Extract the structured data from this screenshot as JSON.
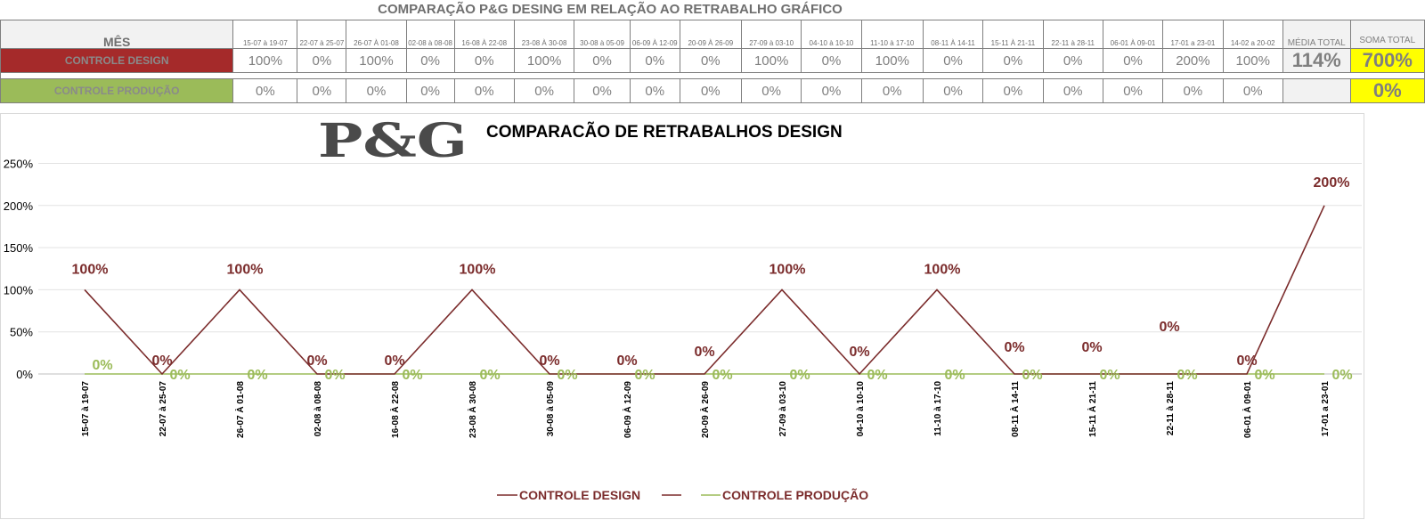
{
  "page_title": "COMPARAÇÃO P&G DESING EM RELAÇÃO AO RETRABALHO GRÁFICO",
  "table": {
    "month_header": "MÊS",
    "periods": [
      "15-07 à 19-07",
      "22-07 à 25-07",
      "26-07 À 01-08",
      "02-08 à 08-08",
      "16-08 À 22-08",
      "23-08 À 30-08",
      "30-08 à 05-09",
      "06-09 À 12-09",
      "20-09 À 26-09",
      "27-09 à 03-10",
      "04-10 à 10-10",
      "11-10 à 17-10",
      "08-11 À 14-11",
      "15-11 À 21-11",
      "22-11 à 28-11",
      "06-01 À 09-01",
      "17-01 a 23-01",
      "14-02 a 20-02"
    ],
    "media_total_header": "MÉDIA TOTAL",
    "soma_total_header": "SOMA TOTAL",
    "rows": [
      {
        "label": "CONTROLE DESIGN",
        "color": "#a52a2a",
        "values": [
          "100%",
          "0%",
          "100%",
          "0%",
          "0%",
          "100%",
          "0%",
          "0%",
          "0%",
          "100%",
          "0%",
          "100%",
          "0%",
          "0%",
          "0%",
          "0%",
          "200%",
          "100%"
        ],
        "media": "114%",
        "soma": "700%"
      },
      {
        "label": "CONTROLE PRODUÇÃO",
        "color": "#9bbb59",
        "values": [
          "0%",
          "0%",
          "0%",
          "0%",
          "0%",
          "0%",
          "0%",
          "0%",
          "0%",
          "0%",
          "0%",
          "0%",
          "0%",
          "0%",
          "0%",
          "0%",
          "0%",
          "0%"
        ],
        "media": "",
        "soma": "0%"
      }
    ]
  },
  "logo_text": "P&G",
  "chart_data": {
    "type": "line",
    "title": "COMPARACÃO DE RETRABALHOS  DESIGN",
    "categories": [
      "15-07 à 19-07",
      "22-07 à 25-07",
      "26-07 À 01-08",
      "02-08 à 08-08",
      "16-08 À 22-08",
      "23-08 À 30-08",
      "30-08 à 05-09",
      "06-09 À 12-09",
      "20-09 À 26-09",
      "27-09 à 03-10",
      "04-10 à 10-10",
      "11-10 à 17-10",
      "08-11 À 14-11",
      "15-11 À 21-11",
      "22-11 à 28-11",
      "06-01 À 09-01",
      "17-01 a 23-01"
    ],
    "series": [
      {
        "name": "CONTROLE DESIGN",
        "color": "#7b2c2c",
        "values": [
          100,
          0,
          100,
          0,
          0,
          100,
          0,
          0,
          0,
          100,
          0,
          100,
          0,
          0,
          0,
          0,
          200
        ],
        "labels": [
          "100%",
          "0%",
          "100%",
          "0%",
          "0%",
          "100%",
          "0%",
          "0%",
          "0%",
          "100%",
          "0%",
          "100%",
          "0%",
          "0%",
          "0%",
          "0%",
          "200%"
        ]
      },
      {
        "name": "CONTROLE PRODUÇÃO",
        "color": "#9bbb59",
        "values": [
          0,
          0,
          0,
          0,
          0,
          0,
          0,
          0,
          0,
          0,
          0,
          0,
          0,
          0,
          0,
          0,
          0
        ],
        "labels": [
          "0%",
          "0%",
          "0%",
          "0%",
          "0%",
          "0%",
          "0%",
          "0%",
          "0%",
          "0%",
          "0%",
          "0%",
          "0%",
          "0%",
          "0%",
          "0%",
          "0%"
        ]
      }
    ],
    "yticks": [
      "0%",
      "50%",
      "100%",
      "150%",
      "200%",
      "250%"
    ],
    "ylim": [
      0,
      250
    ],
    "grid": true,
    "legend_position": "bottom"
  }
}
